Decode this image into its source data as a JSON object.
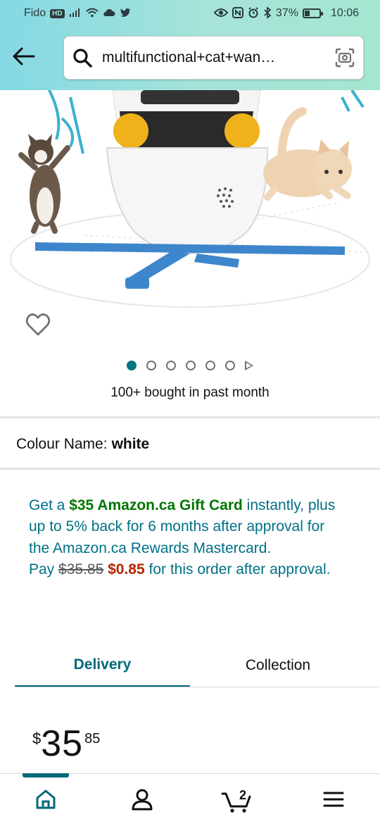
{
  "status_bar": {
    "carrier": "Fido",
    "hd_badge": "HD",
    "battery_text": "37%",
    "battery_level": 0.37,
    "time": "10:06"
  },
  "header": {
    "back_icon": "arrow-left-icon",
    "search_icon": "search-icon",
    "search_query": "multifunctional+cat+wan…",
    "camera_icon": "camera-scan-icon"
  },
  "product": {
    "wishlist_icon": "heart-outline-icon",
    "image_count": 6,
    "active_image_index": 0,
    "bought_text": "100+ bought in past month",
    "colour_label": "Colour Name:",
    "colour_value": "white"
  },
  "promo": {
    "get_a": "Get a ",
    "gift_card": "$35 Amazon.ca Gift Card",
    "rest_line": " instantly, plus up to 5% back for 6 months after approval for the Amazon.ca Rewards Mastercard.",
    "pay": "Pay ",
    "old_price": "$35.85",
    "new_price": "$0.85",
    "after": " for this order after approval."
  },
  "tabs": {
    "delivery": "Delivery",
    "collection": "Collection",
    "active": "Delivery"
  },
  "price": {
    "symbol": "$",
    "whole": "35",
    "fraction": "85"
  },
  "bottom_nav": {
    "cart_count": "2",
    "items": [
      "home-icon",
      "account-icon",
      "cart-icon",
      "menu-icon"
    ]
  },
  "colors": {
    "teal": "#00697a",
    "link": "#007185",
    "green": "#007600",
    "red": "#b12704",
    "header_gradient_start": "#84d8e3",
    "header_gradient_end": "#a5e6d2"
  }
}
